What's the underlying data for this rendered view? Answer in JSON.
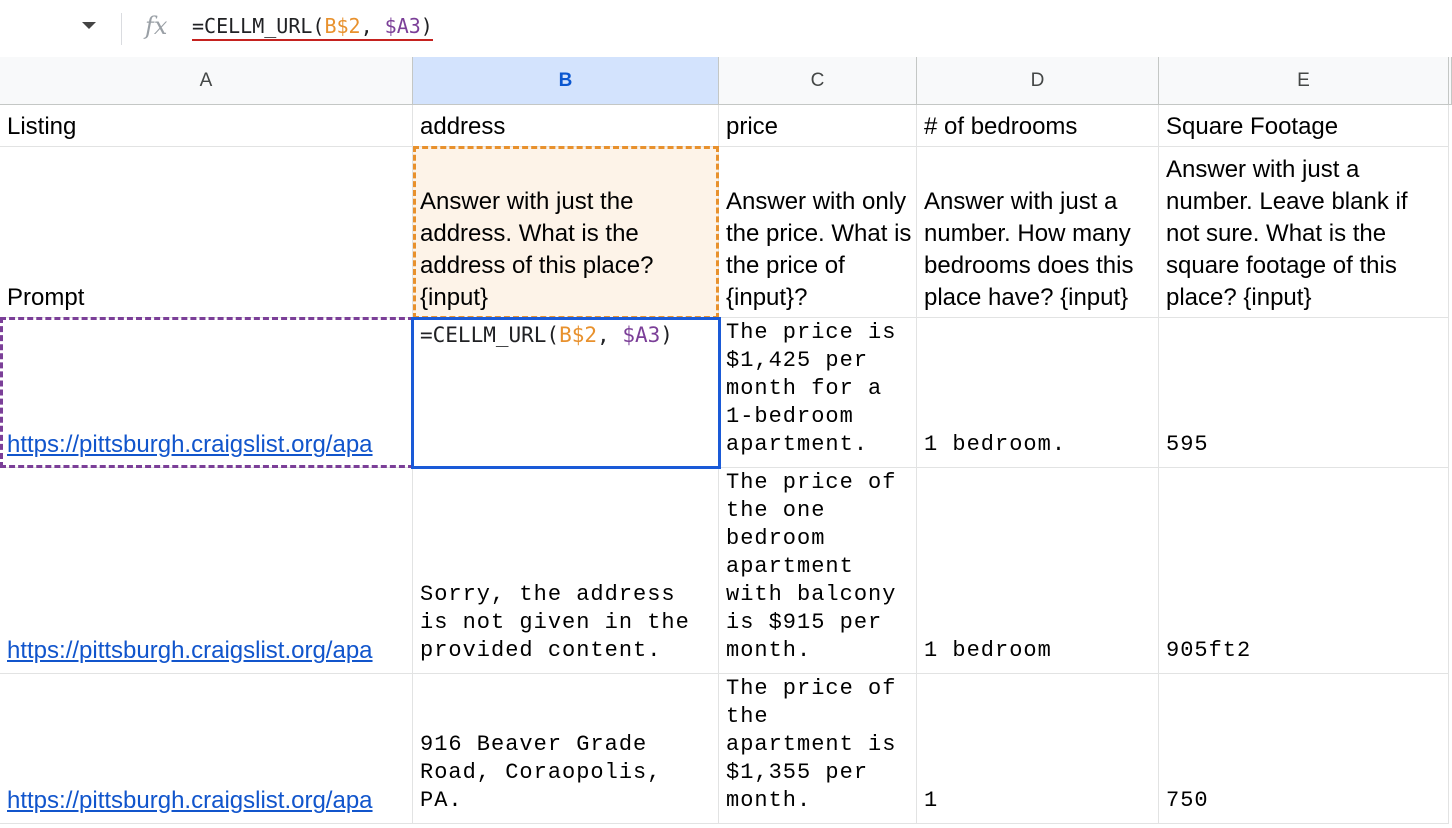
{
  "formula_bar": {
    "name_box_dropdown_icon": "chevron-down-icon",
    "fx_label": "fx",
    "formula_prefix": "=CELLM_URL(",
    "formula_ref_b": "B$2",
    "formula_sep": ", ",
    "formula_ref_a": "$A3",
    "formula_suffix": ")"
  },
  "columns": [
    "A",
    "B",
    "C",
    "D",
    "E"
  ],
  "selected_column": "B",
  "colors": {
    "ref_b": "#e8912d",
    "ref_a": "#7b3f98",
    "link": "#1155cc",
    "selection": "#1a5ad7"
  },
  "rows": {
    "header": {
      "a": "Listing",
      "b": "address",
      "c": "price",
      "d": "# of bedrooms",
      "e": "Square Footage"
    },
    "prompt": {
      "a": "Prompt",
      "b": "Answer with just the address. What is the address of this place? {input}",
      "c": "Answer with only the price. What is the price of {input}?",
      "d": "Answer with just a number. How many bedrooms does this place have? {input}",
      "e": "Answer with just a number. Leave blank if not sure. What is the square footage of this place? {input}"
    },
    "listing1": {
      "a": "https://pittsburgh.craigslist.org/apa",
      "b_prefix": "=CELLM_URL(",
      "b_ref_b": "B$2",
      "b_sep": ", ",
      "b_ref_a": "$A3",
      "b_suffix": ")",
      "c": "The price is\n$1,425 per\nmonth for a\n1-bedroom\napartment.",
      "d": "1 bedroom.",
      "e": "595"
    },
    "listing2": {
      "a": "https://pittsburgh.craigslist.org/apa",
      "b": "Sorry, the address\nis not given in the\nprovided content.",
      "c": "The price of\nthe one\nbedroom\napartment\nwith balcony\nis $915 per\nmonth.",
      "d": "1 bedroom",
      "e": "905ft2"
    },
    "listing3": {
      "a": "https://pittsburgh.craigslist.org/apa",
      "b": "916 Beaver Grade\nRoad, Coraopolis,\nPA.",
      "c": "The price of\nthe\napartment is\n$1,355 per\nmonth.",
      "d": "1",
      "e": "750"
    }
  }
}
